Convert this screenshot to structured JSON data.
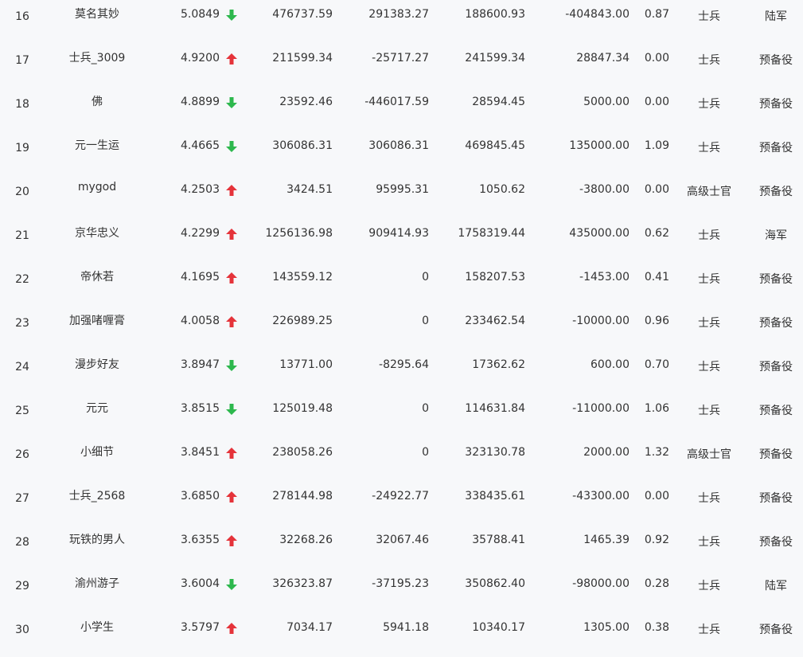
{
  "colors": {
    "up": "#e5333a",
    "down": "#2db84d"
  },
  "rows": [
    {
      "rank": "16",
      "name": "莫名其妙",
      "score": "5.0849",
      "trend": "down",
      "c1": "476737.59",
      "c2": "291383.27",
      "c3": "188600.93",
      "c4": "-404843.00",
      "c5": "0.87",
      "rank_title": "士兵",
      "branch": "陆军"
    },
    {
      "rank": "17",
      "name": "士兵_3009",
      "score": "4.9200",
      "trend": "up",
      "c1": "211599.34",
      "c2": "-25717.27",
      "c3": "241599.34",
      "c4": "28847.34",
      "c5": "0.00",
      "rank_title": "士兵",
      "branch": "预备役"
    },
    {
      "rank": "18",
      "name": "佛",
      "score": "4.8899",
      "trend": "down",
      "c1": "23592.46",
      "c2": "-446017.59",
      "c3": "28594.45",
      "c4": "5000.00",
      "c5": "0.00",
      "rank_title": "士兵",
      "branch": "预备役"
    },
    {
      "rank": "19",
      "name": "元一生运",
      "score": "4.4665",
      "trend": "down",
      "c1": "306086.31",
      "c2": "306086.31",
      "c3": "469845.45",
      "c4": "135000.00",
      "c5": "1.09",
      "rank_title": "士兵",
      "branch": "预备役"
    },
    {
      "rank": "20",
      "name": "mygod",
      "score": "4.2503",
      "trend": "up",
      "c1": "3424.51",
      "c2": "95995.31",
      "c3": "1050.62",
      "c4": "-3800.00",
      "c5": "0.00",
      "rank_title": "高级士官",
      "branch": "预备役"
    },
    {
      "rank": "21",
      "name": "京华忠义",
      "score": "4.2299",
      "trend": "up",
      "c1": "1256136.98",
      "c2": "909414.93",
      "c3": "1758319.44",
      "c4": "435000.00",
      "c5": "0.62",
      "rank_title": "士兵",
      "branch": "海军"
    },
    {
      "rank": "22",
      "name": "帝休若",
      "score": "4.1695",
      "trend": "up",
      "c1": "143559.12",
      "c2": "0",
      "c3": "158207.53",
      "c4": "-1453.00",
      "c5": "0.41",
      "rank_title": "士兵",
      "branch": "预备役"
    },
    {
      "rank": "23",
      "name": "加强啫喱膏",
      "score": "4.0058",
      "trend": "up",
      "c1": "226989.25",
      "c2": "0",
      "c3": "233462.54",
      "c4": "-10000.00",
      "c5": "0.96",
      "rank_title": "士兵",
      "branch": "预备役"
    },
    {
      "rank": "24",
      "name": "漫步好友",
      "score": "3.8947",
      "trend": "down",
      "c1": "13771.00",
      "c2": "-8295.64",
      "c3": "17362.62",
      "c4": "600.00",
      "c5": "0.70",
      "rank_title": "士兵",
      "branch": "预备役"
    },
    {
      "rank": "25",
      "name": "元元",
      "score": "3.8515",
      "trend": "down",
      "c1": "125019.48",
      "c2": "0",
      "c3": "114631.84",
      "c4": "-11000.00",
      "c5": "1.06",
      "rank_title": "士兵",
      "branch": "预备役"
    },
    {
      "rank": "26",
      "name": "小细节",
      "score": "3.8451",
      "trend": "up",
      "c1": "238058.26",
      "c2": "0",
      "c3": "323130.78",
      "c4": "2000.00",
      "c5": "1.32",
      "rank_title": "高级士官",
      "branch": "预备役"
    },
    {
      "rank": "27",
      "name": "士兵_2568",
      "score": "3.6850",
      "trend": "up",
      "c1": "278144.98",
      "c2": "-24922.77",
      "c3": "338435.61",
      "c4": "-43300.00",
      "c5": "0.00",
      "rank_title": "士兵",
      "branch": "预备役"
    },
    {
      "rank": "28",
      "name": "玩铁的男人",
      "score": "3.6355",
      "trend": "up",
      "c1": "32268.26",
      "c2": "32067.46",
      "c3": "35788.41",
      "c4": "1465.39",
      "c5": "0.92",
      "rank_title": "士兵",
      "branch": "预备役"
    },
    {
      "rank": "29",
      "name": "渝州游子",
      "score": "3.6004",
      "trend": "down",
      "c1": "326323.87",
      "c2": "-37195.23",
      "c3": "350862.40",
      "c4": "-98000.00",
      "c5": "0.28",
      "rank_title": "士兵",
      "branch": "陆军"
    },
    {
      "rank": "30",
      "name": "小学生",
      "score": "3.5797",
      "trend": "up",
      "c1": "7034.17",
      "c2": "5941.18",
      "c3": "10340.17",
      "c4": "1305.00",
      "c5": "0.38",
      "rank_title": "士兵",
      "branch": "预备役"
    }
  ]
}
